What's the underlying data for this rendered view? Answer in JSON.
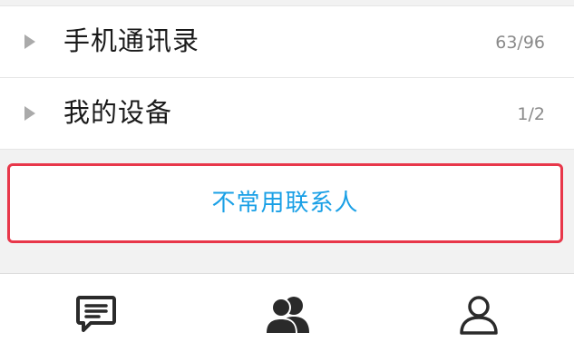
{
  "contact_groups": [
    {
      "name": "手机通讯录",
      "count": "63/96"
    },
    {
      "name": "我的设备",
      "count": "1/2"
    }
  ],
  "uncommon_contacts": {
    "label": "不常用联系人"
  },
  "bottom_tabs": [
    {
      "icon": "message-icon"
    },
    {
      "icon": "contacts-icon",
      "active": true
    },
    {
      "icon": "profile-icon"
    }
  ],
  "colors": {
    "accent": "#1aa0e6",
    "highlight_border": "#e8374a",
    "text_primary": "#1a1a1a",
    "text_secondary": "#8a8a8a",
    "icon": "#2a2a2a"
  }
}
